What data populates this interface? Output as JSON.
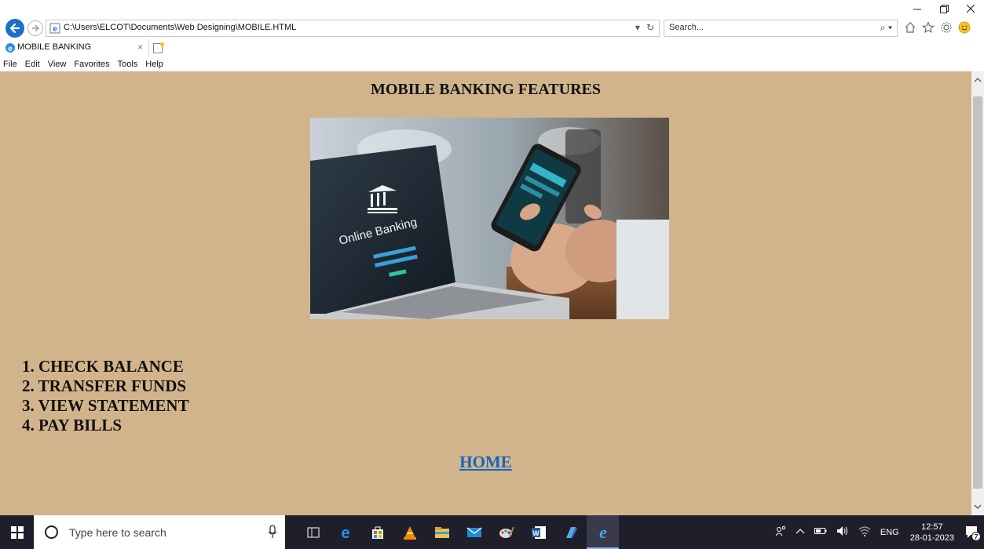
{
  "browser": {
    "address": "C:\\Users\\ELCOT\\Documents\\Web Designing\\MOBILE.HTML",
    "search_placeholder": "Search...",
    "tab_title": "MOBILE BANKING",
    "menu": [
      "File",
      "Edit",
      "View",
      "Favorites",
      "Tools",
      "Help"
    ]
  },
  "page": {
    "title": "MOBILE BANKING FEATURES",
    "banner": {
      "text": "Online Banking"
    },
    "features": [
      "1. CHECK BALANCE",
      "2. TRANSFER FUNDS",
      "3. VIEW STATEMENT",
      "4. PAY BILLS"
    ],
    "home_link": "HOME",
    "background_color": "#d2b48c"
  },
  "taskbar": {
    "search_placeholder": "Type here to search",
    "language": "ENG",
    "time": "12:57",
    "date": "28-01-2023",
    "notification_count": "7"
  }
}
